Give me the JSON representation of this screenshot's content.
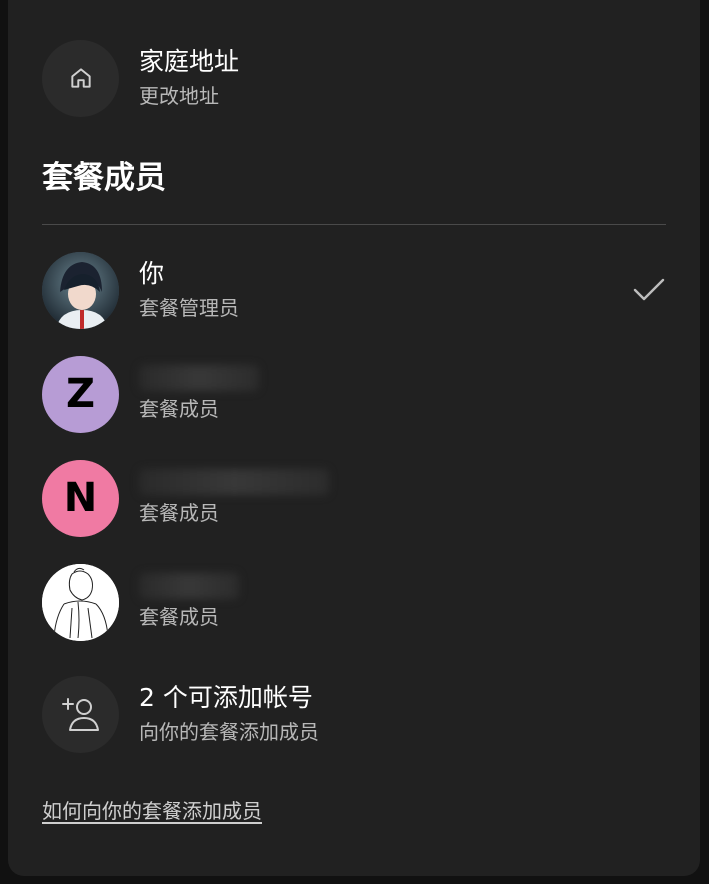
{
  "address": {
    "title": "家庭地址",
    "subtitle": "更改地址",
    "icon": "home-icon"
  },
  "section": {
    "title": "套餐成员"
  },
  "members": [
    {
      "name": "你",
      "role": "套餐管理员",
      "avatar": "anime-avatar",
      "selected": true
    },
    {
      "initial": "Z",
      "role": "套餐成员",
      "color": "#b79cd5",
      "name_redacted": true
    },
    {
      "initial": "N",
      "role": "套餐成员",
      "color": "#f07aa3",
      "name_redacted": true
    },
    {
      "role": "套餐成员",
      "avatar": "sketch-avatar",
      "name_redacted": true
    }
  ],
  "add_member": {
    "title": "2 个可添加帐号",
    "subtitle": "向你的套餐添加成员",
    "icon": "add-person-icon"
  },
  "footer": {
    "link": "如何向你的套餐添加成员"
  }
}
